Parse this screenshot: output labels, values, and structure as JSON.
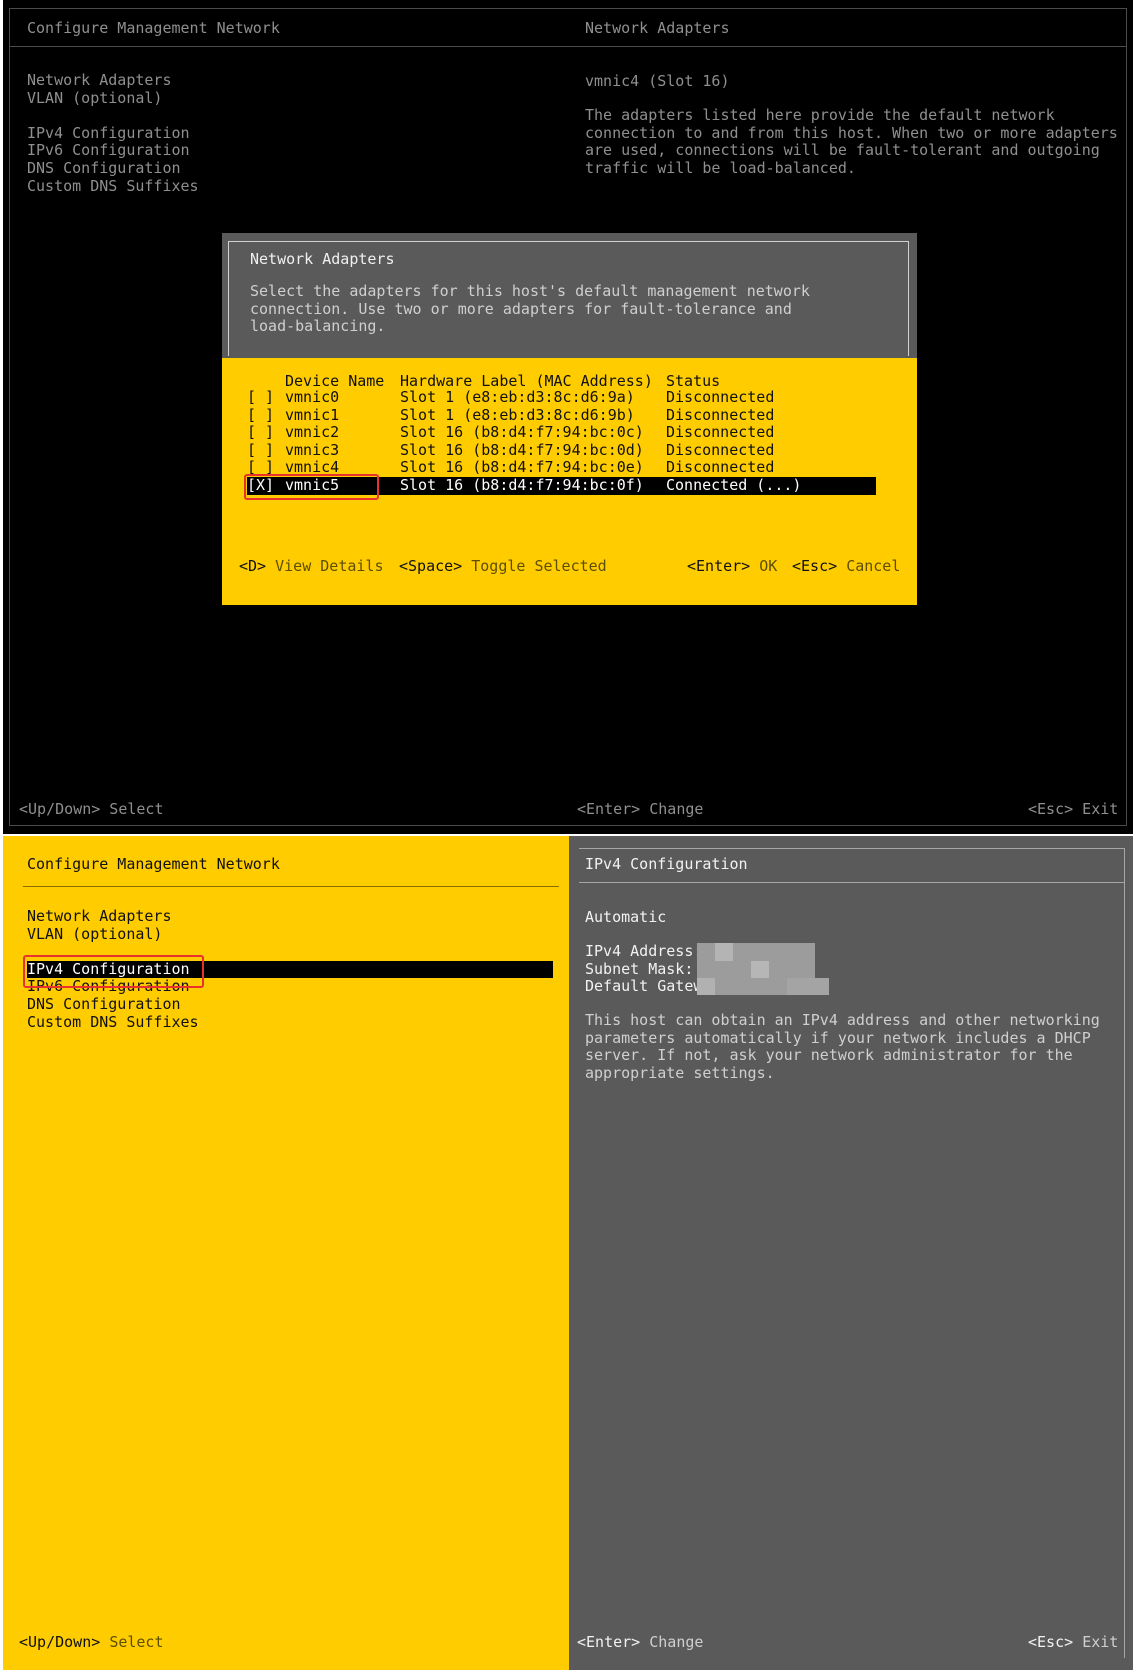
{
  "top": {
    "left_title": "Configure Management Network",
    "right_title": "Network Adapters",
    "menu": [
      "Network Adapters",
      "VLAN (optional)",
      "",
      "IPv4 Configuration",
      "IPv6 Configuration",
      "DNS Configuration",
      "Custom DNS Suffixes"
    ],
    "info_heading": "vmnic4 (Slot 16)",
    "info_lines": [
      "The adapters listed here provide the default network",
      "connection to and from this host. When two or more adapters",
      "are used, connections will be fault-tolerant and outgoing",
      "traffic will be load-balanced."
    ],
    "footer": {
      "select": "<Up/Down> Select",
      "change": "<Enter> Change",
      "exit": "<Esc> Exit"
    }
  },
  "dialog": {
    "title": "Network Adapters",
    "desc_lines": [
      "Select the adapters for this host's default management network",
      "connection. Use two or more adapters for fault-tolerance and",
      "load-balancing."
    ],
    "columns": {
      "name": "Device Name",
      "hw": "Hardware Label (MAC Address)",
      "status": "Status"
    },
    "adapters": [
      {
        "check": "[ ]",
        "name": "vmnic0",
        "hw": "Slot 1 (e8:eb:d3:8c:d6:9a)",
        "status": "Disconnected"
      },
      {
        "check": "[ ]",
        "name": "vmnic1",
        "hw": "Slot 1 (e8:eb:d3:8c:d6:9b)",
        "status": "Disconnected"
      },
      {
        "check": "[ ]",
        "name": "vmnic2",
        "hw": "Slot 16 (b8:d4:f7:94:bc:0c)",
        "status": "Disconnected"
      },
      {
        "check": "[ ]",
        "name": "vmnic3",
        "hw": "Slot 16 (b8:d4:f7:94:bc:0d)",
        "status": "Disconnected"
      },
      {
        "check": "[ ]",
        "name": "vmnic4",
        "hw": "Slot 16 (b8:d4:f7:94:bc:0e)",
        "status": "Disconnected"
      },
      {
        "check": "[X]",
        "name": "vmnic5",
        "hw": "Slot 16 (b8:d4:f7:94:bc:0f)",
        "status": "Connected (...)"
      }
    ],
    "selected_index": 5,
    "keys": [
      {
        "key": "<D>",
        "label": "View Details"
      },
      {
        "key": "<Space>",
        "label": "Toggle Selected"
      },
      {
        "key": "<Enter>",
        "label": "OK"
      },
      {
        "key": "<Esc>",
        "label": "Cancel"
      }
    ]
  },
  "bottom": {
    "left_title": "Configure Management Network",
    "right_title": "IPv4 Configuration",
    "menu": [
      "Network Adapters",
      "VLAN (optional)",
      "",
      "IPv4 Configuration",
      "IPv6 Configuration",
      "DNS Configuration",
      "Custom DNS Suffixes"
    ],
    "selected_menu": "IPv4 Configuration",
    "mode": "Automatic",
    "fields": [
      {
        "label": "IPv4 Address:",
        "value": ""
      },
      {
        "label": "Subnet Mask:",
        "value": ""
      },
      {
        "label": "Default Gatew",
        "value": ""
      }
    ],
    "desc_lines": [
      "This host can obtain an IPv4 address and other networking",
      "parameters automatically if your network includes a DHCP",
      "server. If not, ask your network administrator for the",
      "appropriate settings."
    ],
    "footer": {
      "select_key": "<Up/Down>",
      "select_label": "Select",
      "change_key": "<Enter>",
      "change_label": "Change",
      "exit_key": "<Esc>",
      "exit_label": "Exit"
    }
  }
}
